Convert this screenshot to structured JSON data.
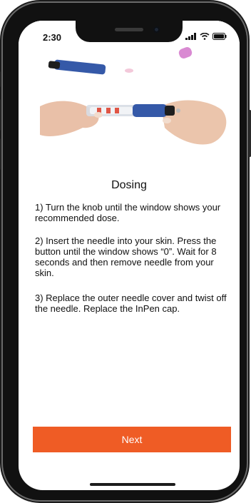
{
  "status_bar": {
    "time": "2:30",
    "icons": [
      "signal-icon",
      "wifi-icon",
      "battery-icon"
    ]
  },
  "hero_image": {
    "subject": "insulin-pen-illustration"
  },
  "page": {
    "title": "Dosing",
    "steps": [
      "1) Turn the knob until the window shows your recommended dose.",
      "2) Insert the needle into your skin. Press the button until the window shows “0”.  Wait for 8 seconds and then remove needle from your skin.",
      "3) Replace the outer needle cover and twist off the needle. Replace the InPen cap."
    ]
  },
  "actions": {
    "next_label": "Next"
  },
  "colors": {
    "accent": "#ef5c25",
    "pen_blue": "#3559a8"
  }
}
